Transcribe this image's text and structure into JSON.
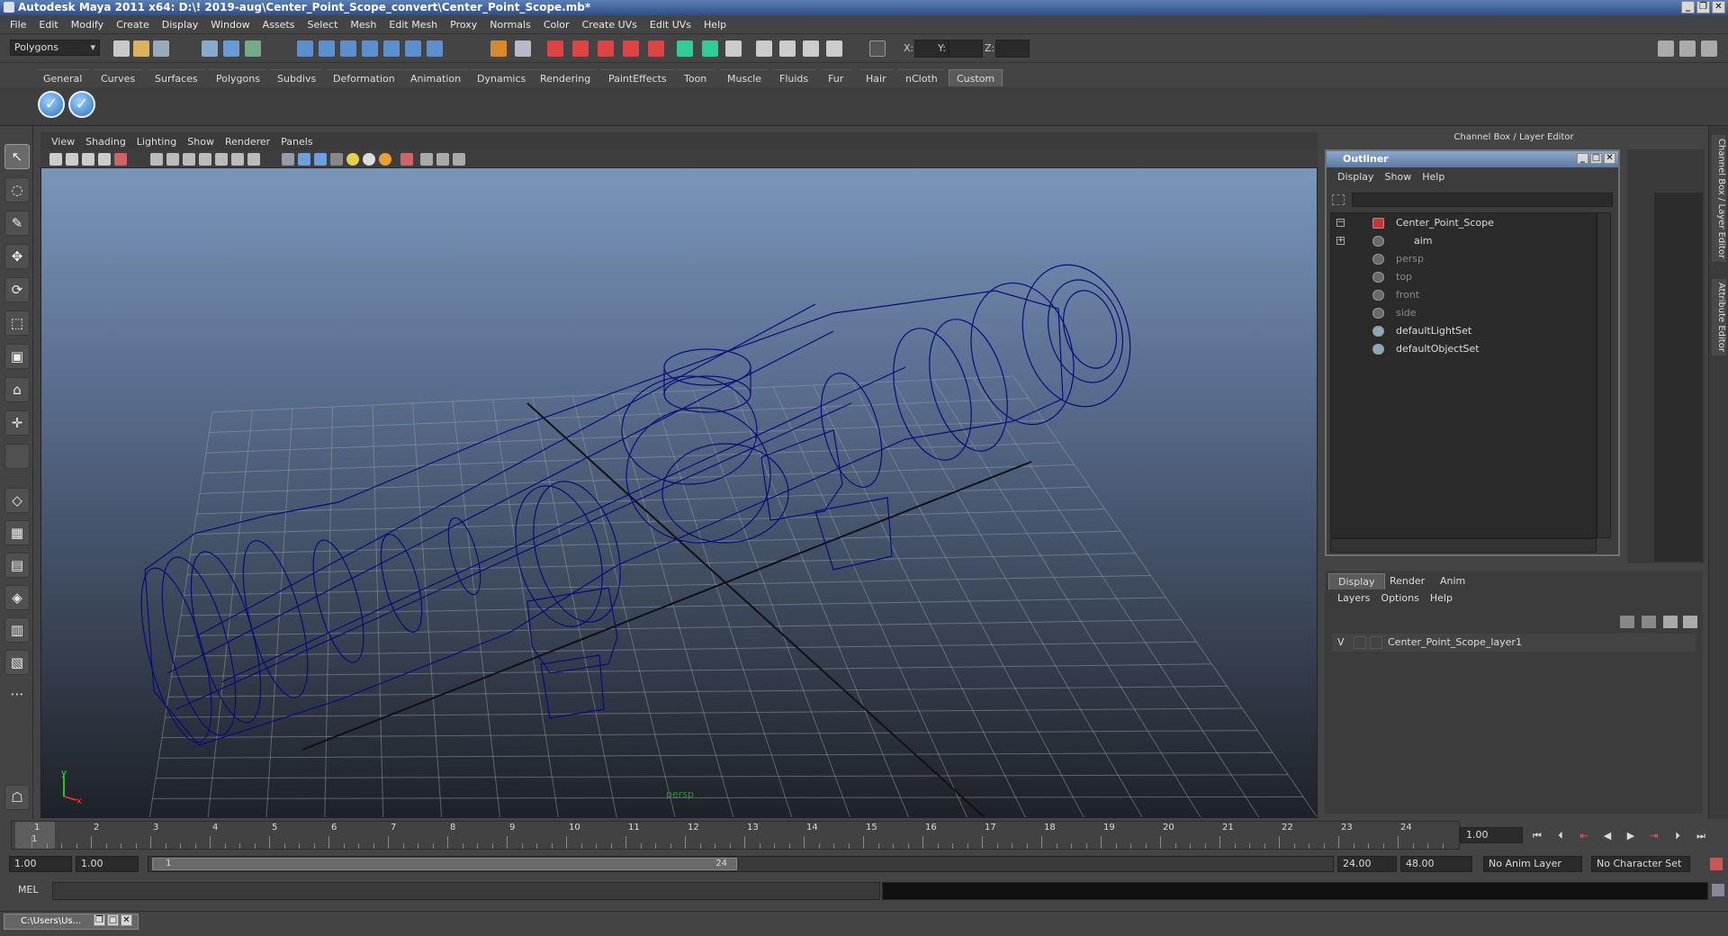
{
  "window": {
    "title": "Autodesk Maya 2011 x64: D:\\! 2019-aug\\Center_Point_Scope_convert\\Center_Point_Scope.mb*"
  },
  "menubar": [
    "File",
    "Edit",
    "Modify",
    "Create",
    "Display",
    "Window",
    "Assets",
    "Select",
    "Mesh",
    "Edit Mesh",
    "Proxy",
    "Normals",
    "Color",
    "Create UVs",
    "Edit UVs",
    "Help"
  ],
  "statusline": {
    "mode": "Polygons",
    "x_label": "X:",
    "y_label": "Y:",
    "z_label": "Z:"
  },
  "shelf": {
    "tabs": [
      "General",
      "Curves",
      "Surfaces",
      "Polygons",
      "Subdivs",
      "Deformation",
      "Animation",
      "Dynamics",
      "Rendering",
      "PaintEffects",
      "Toon",
      "Muscle",
      "Fluids",
      "Fur",
      "Hair",
      "nCloth",
      "Custom"
    ],
    "active_tab": "Custom"
  },
  "viewport": {
    "menu": [
      "View",
      "Shading",
      "Lighting",
      "Show",
      "Renderer",
      "Panels"
    ],
    "camera_label": "persp",
    "axis_x": "x",
    "axis_y": "y",
    "wire_color": "#0b0b7a"
  },
  "channel_box": {
    "title": "Channel Box / Layer Editor"
  },
  "outliner": {
    "title": "Outliner",
    "menu": [
      "Display",
      "Show",
      "Help"
    ],
    "items": [
      {
        "label": "Center_Point_Scope",
        "dim": false
      },
      {
        "label": "aim",
        "dim": false
      },
      {
        "label": "persp",
        "dim": true
      },
      {
        "label": "top",
        "dim": true
      },
      {
        "label": "front",
        "dim": true
      },
      {
        "label": "side",
        "dim": true
      },
      {
        "label": "defaultLightSet",
        "dim": false
      },
      {
        "label": "defaultObjectSet",
        "dim": false
      }
    ]
  },
  "layer_editor": {
    "tabs": [
      "Display",
      "Render",
      "Anim"
    ],
    "menu": [
      "Layers",
      "Options",
      "Help"
    ],
    "layer": {
      "visible": "V",
      "name": "Center_Point_Scope_layer1"
    }
  },
  "right_tabs": [
    "Channel Box / Layer Editor",
    "Attribute Editor"
  ],
  "timeline": {
    "ticks": [
      "1",
      "2",
      "3",
      "4",
      "5",
      "6",
      "7",
      "8",
      "9",
      "10",
      "11",
      "12",
      "13",
      "14",
      "15",
      "16",
      "17",
      "18",
      "19",
      "20",
      "21",
      "22",
      "23",
      "24"
    ],
    "current_frame": "1.00",
    "playhead_label": "1"
  },
  "range": {
    "start": "1.00",
    "anim_start": "1.00",
    "slider_start": "1",
    "slider_end": "24",
    "end": "24.00",
    "anim_end": "48.00",
    "anim_layer": "No Anim Layer",
    "char_set": "No Character Set"
  },
  "command_line": {
    "label": "MEL"
  },
  "taskbar": {
    "item": "C:\\Users\\Us..."
  }
}
